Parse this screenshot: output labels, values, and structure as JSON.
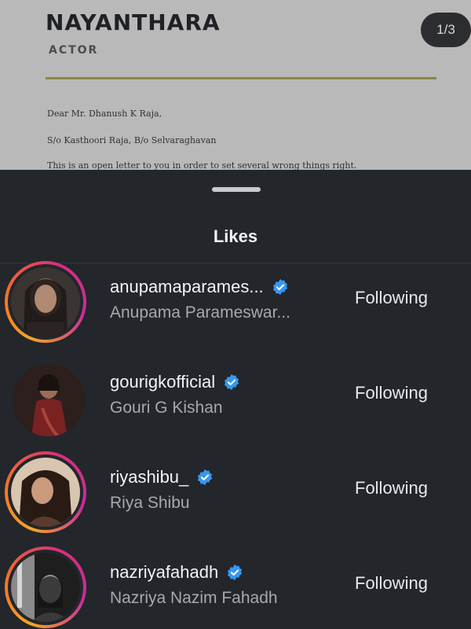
{
  "letter": {
    "name": "NAYANTHARA",
    "role": "ACTOR",
    "lines": [
      "Dear Mr. Dhanush K Raja,",
      "S/o Kasthoori Raja, B/o Selvaraghavan",
      "This is an open letter to you in order to set several wrong things right."
    ],
    "page_indicator": "1/3"
  },
  "sheet": {
    "title": "Likes",
    "users": [
      {
        "username": "anupamaparames...",
        "full_name": "Anupama Parameswar...",
        "button": "Following",
        "verified": true,
        "story_ring": true
      },
      {
        "username": "gourigkofficial",
        "full_name": "Gouri G Kishan",
        "button": "Following",
        "verified": true,
        "story_ring": false
      },
      {
        "username": "riyashibu_",
        "full_name": "Riya Shibu",
        "button": "Following",
        "verified": true,
        "story_ring": true
      },
      {
        "username": "nazriyafahadh",
        "full_name": "Nazriya Nazim Fahadh",
        "button": "Following",
        "verified": true,
        "story_ring": true
      }
    ]
  },
  "colors": {
    "sheet_bg": "#23262b",
    "verified_blue": "#3897f0",
    "story_ring_start": "#f5a524",
    "story_ring_end": "#c52d9b"
  },
  "icons": [
    "verified-badge-icon",
    "sheet-drag-handle"
  ]
}
